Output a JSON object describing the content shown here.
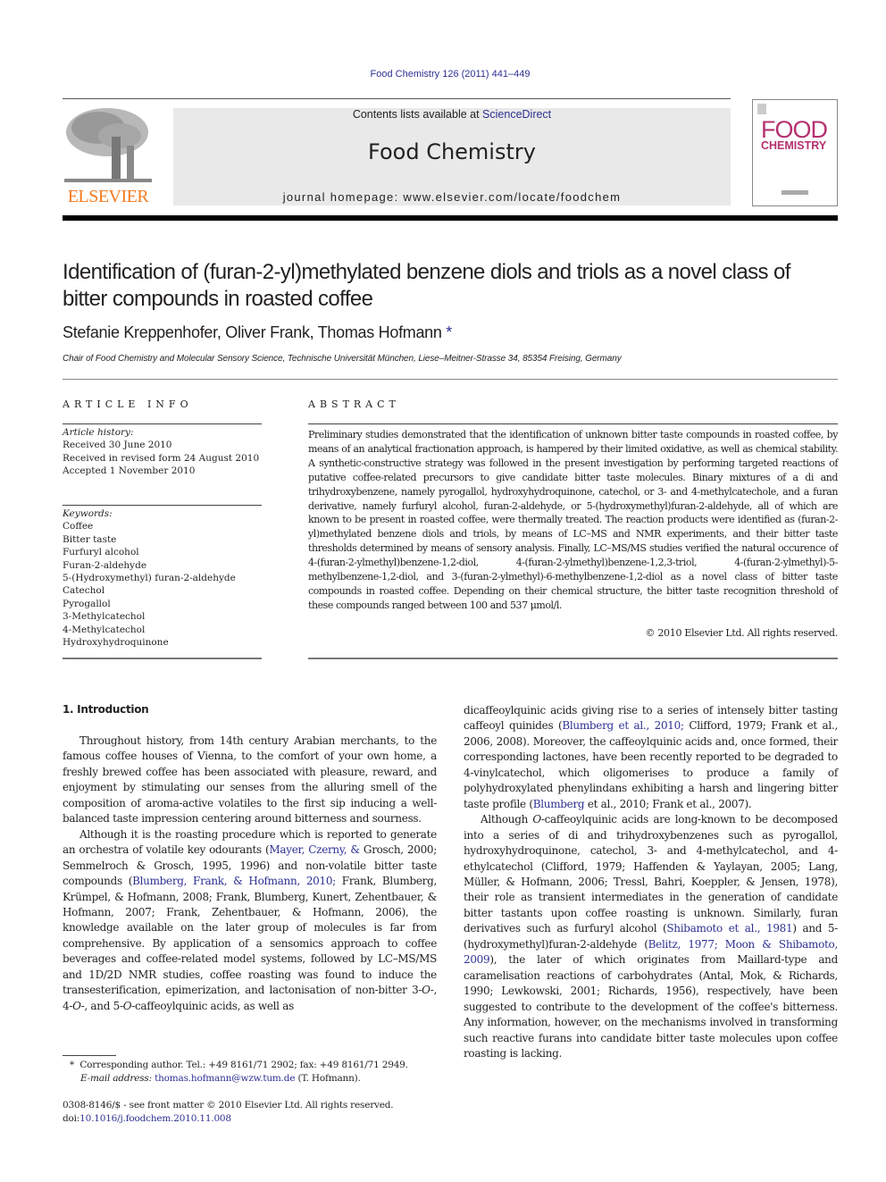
{
  "header": {
    "citation": "Food Chemistry 126 (2011) 441–449",
    "contents_prefix": "Contents lists available at ",
    "contents_link": "ScienceDirect",
    "journal_name": "Food Chemistry",
    "homepage": "journal homepage: www.elsevier.com/locate/foodchem",
    "publisher_logo_text": "ELSEVIER",
    "cover": {
      "line1": "FOOD",
      "line2": "CHEMISTRY"
    },
    "colors": {
      "link": "#2e3192",
      "elsevier_orange": "#f47b20",
      "cover_magenta": "#b5306f"
    }
  },
  "article": {
    "title": "Identification of (furan-2-yl)methylated benzene diols and triols as a novel class of bitter compounds in roasted coffee",
    "authors": "Stefanie Kreppenhofer, Oliver Frank, Thomas Hofmann",
    "author_mark": "*",
    "affiliation": "Chair of Food Chemistry and Molecular Sensory Science, Technische Universität München, Liese–Meitner-Strasse 34, 85354 Freising, Germany"
  },
  "article_info": {
    "heading": "ARTICLE INFO",
    "history_label": "Article history:",
    "history": [
      "Received 30 June 2010",
      "Received in revised form 24 August 2010",
      "Accepted 1 November 2010"
    ],
    "keywords_label": "Keywords:",
    "keywords": [
      "Coffee",
      "Bitter taste",
      "Furfuryl alcohol",
      "Furan-2-aldehyde",
      "5-(Hydroxymethyl) furan-2-aldehyde",
      "Catechol",
      "Pyrogallol",
      "3-Methylcatechol",
      "4-Methylcatechol",
      "Hydroxyhydroquinone"
    ]
  },
  "abstract": {
    "heading": "ABSTRACT",
    "body": "Preliminary studies demonstrated that the identification of unknown bitter taste compounds in roasted coffee, by means of an analytical fractionation approach, is hampered by their limited oxidative, as well as chemical stability. A synthetic-constructive strategy was followed in the present investigation by performing targeted reactions of putative coffee-related precursors to give candidate bitter taste molecules. Binary mixtures of a di and trihydroxybenzene, namely pyrogallol, hydroxyhydroquinone, catechol, or 3- and 4-methylcatechole, and a furan derivative, namely furfuryl alcohol, furan-2-aldehyde, or 5-(hydroxymethyl)furan-2-aldehyde, all of which are known to be present in roasted coffee, were thermally treated. The reaction products were identified as (furan-2-yl)methylated benzene diols and triols, by means of LC–MS and NMR experiments, and their bitter taste thresholds determined by means of sensory analysis. Finally, LC–MS/MS studies verified the natural occurence of 4-(furan-2-ylmethyl)benzene-1,2-diol, 4-(furan-2-ylmethyl)benzene-1,2,3-triol, 4-(furan-2-ylmethyl)-5-methylbenzene-1,2-diol, and 3-(furan-2-ylmethyl)-6-methylbenzene-1,2-diol as a novel class of bitter taste compounds in roasted coffee. Depending on their chemical structure, the bitter taste recognition threshold of these compounds ranged between 100 and 537 μmol/l.",
    "copyright": "© 2010 Elsevier Ltd. All rights reserved."
  },
  "intro": {
    "heading": "1. Introduction",
    "p1": "Throughout history, from 14th century Arabian merchants, to the famous coffee houses of Vienna, to the comfort of your own home, a freshly brewed coffee has been associated with pleasure, reward, and enjoyment by stimulating our senses from the alluring smell of the composition of aroma-active volatiles to the first sip inducing a well-balanced taste impression centering around bitterness and sourness.",
    "p2": {
      "a": "Although it is the roasting procedure which is reported to generate an orchestra of volatile key odourants (",
      "link1": "Mayer, Czerny, &",
      "b": " Grosch, 2000; Semmelroch & Grosch, 1995, 1996) and non-volatile bitter taste compounds (",
      "link2": "Blumberg, Frank, & Hofmann, 2010;",
      "c": " Frank, Blumberg, Krümpel, & Hofmann, 2008; Frank, Blumberg, Kunert, Zehentbauer, & Hofmann, 2007; Frank, Zehentbauer, & Hofmann, 2006), the knowledge available on the later group of molecules is far from comprehensive. By application of a sensomics approach to coffee beverages and coffee-related model systems, followed by LC–MS/MS and 1D/2D NMR studies, coffee roasting was found to induce the transesterification, epimerization, and lactonisation of non-bitter 3-",
      "o1": "O",
      "d": "-, 4-",
      "o2": "O",
      "e": "-, and 5-",
      "o3": "O",
      "f": "-caffeoylquinic acids, as well as"
    },
    "p3": {
      "a": "dicaffeoylquinic acids giving rise to a series of intensely bitter tasting caffeoyl quinides (",
      "link1": "Blumberg et al., 2010;",
      "b": " Clifford, 1979; Frank et al., 2006, 2008). Moreover, the caffeoylquinic acids and, once formed, their corresponding lactones, have been recently reported to be degraded to 4-vinylcatechol, which oligomerises to produce a family of polyhydroxylated phenylindans exhibiting a harsh and lingering bitter taste profile (",
      "link2": "Blumberg",
      "c": " et al., 2010; Frank et al., 2007)."
    },
    "p4": {
      "a": "Although ",
      "o1": "O",
      "b": "-caffeoylquinic acids are long-known to be decomposed into a series of di and trihydroxybenzenes such as pyrogallol, hydroxyhydroquinone, catechol, 3- and 4-methylcatechol, and 4-ethylcatechol (Clifford, 1979; Haffenden & Yaylayan, 2005; Lang, Müller, & Hofmann, 2006; Tressl, Bahri, Koeppler, & Jensen, 1978), their role as transient intermediates in the generation of candidate bitter tastants upon coffee roasting is unknown. Similarly, furan derivatives such as furfuryl alcohol (",
      "link1": "Shibamoto et al., 1981",
      "c": ") and 5-(hydroxymethyl)furan-2-aldehyde (",
      "link2": "Belitz, 1977; Moon & Shibamoto, 2009",
      "d": "), the later of which originates from Maillard-type and caramelisation reactions of carbohydrates (Antal, Mok, & Richards, 1990; Lewkowski, 2001; Richards, 1956), respectively, have been suggested to contribute to the development of the coffee's bitterness. Any information, however, on the mechanisms involved in transforming such reactive furans into candidate bitter taste molecules upon coffee roasting is lacking."
    }
  },
  "footnote": {
    "mark": "*",
    "corresponding": "Corresponding author. Tel.: +49 8161/71 2902; fax: +49 8161/71 2949.",
    "email_label": "E-mail address:",
    "email": "thomas.hofmann@wzw.tum.de",
    "email_suffix": " (T. Hofmann).",
    "front_matter": "0308-8146/$ - see front matter © 2010 Elsevier Ltd. All rights reserved.",
    "doi_label": "doi:",
    "doi": "10.1016/j.foodchem.2010.11.008"
  }
}
